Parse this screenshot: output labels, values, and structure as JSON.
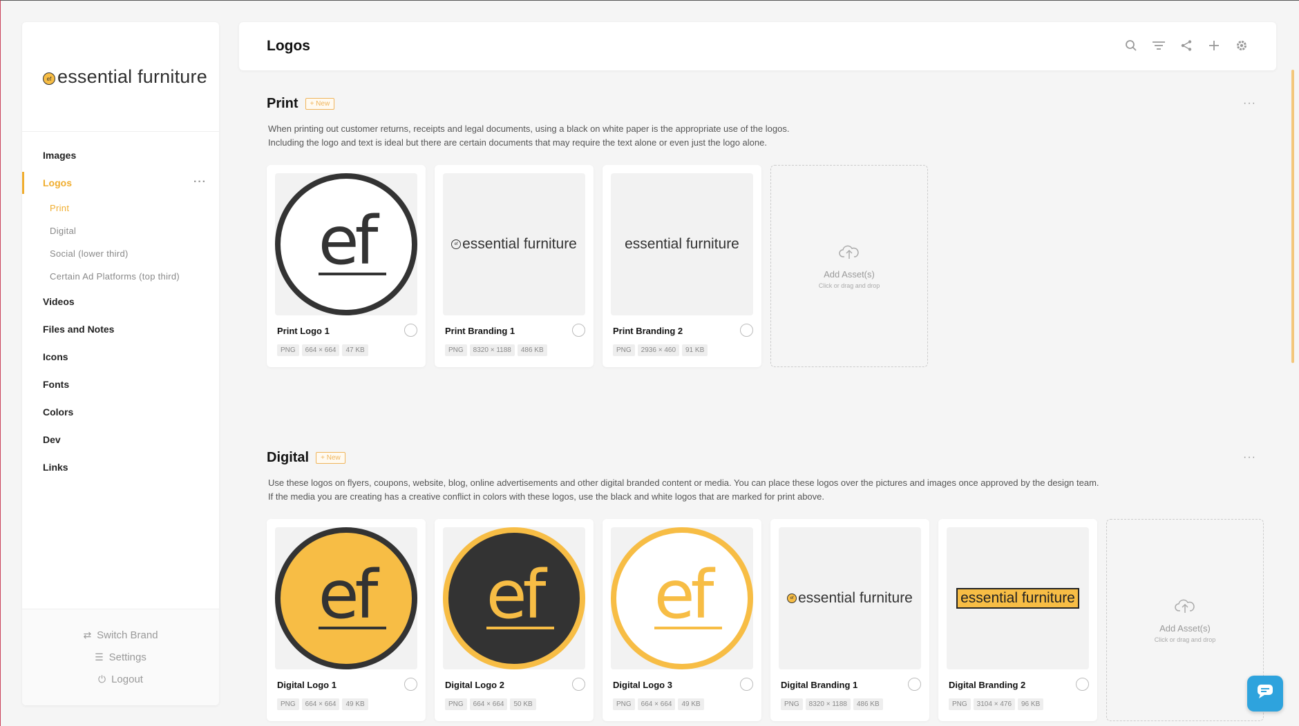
{
  "brand": {
    "name": "essential furniture",
    "mark": "ef"
  },
  "sidebar": {
    "items": [
      {
        "label": "Images"
      },
      {
        "label": "Logos"
      },
      {
        "label": "Videos"
      },
      {
        "label": "Files and Notes"
      },
      {
        "label": "Icons"
      },
      {
        "label": "Fonts"
      },
      {
        "label": "Colors"
      },
      {
        "label": "Dev"
      },
      {
        "label": "Links"
      }
    ],
    "logos_sub": [
      "Print",
      "Digital",
      "Social (lower third)",
      "Certain Ad Platforms (top third)"
    ],
    "footer": {
      "switch_brand": "Switch Brand",
      "settings": "Settings",
      "logout": "Logout"
    }
  },
  "header": {
    "title": "Logos"
  },
  "sections": {
    "print": {
      "title": "Print",
      "badge": "+ New",
      "desc1": "When printing out customer returns, receipts and legal documents, using a black on white paper is the appropriate use of the logos.",
      "desc2": "Including the logo and text is ideal but there are certain documents that may require the text alone or even just the logo alone.",
      "cards": [
        {
          "title": "Print Logo 1",
          "type": "PNG",
          "dims": "664 × 664",
          "size": "47 KB"
        },
        {
          "title": "Print Branding 1",
          "type": "PNG",
          "dims": "8320 × 1188",
          "size": "486 KB"
        },
        {
          "title": "Print Branding 2",
          "type": "PNG",
          "dims": "2936 × 460",
          "size": "91 KB"
        }
      ]
    },
    "digital": {
      "title": "Digital",
      "badge": "+ New",
      "desc1": "Use these logos on flyers, coupons, website, blog, online advertisements and other digital branded content or media. You can place these logos over the pictures and images once approved by the design team.",
      "desc2": "If the media you are creating has a creative conflict in colors  with these logos, use the black and white logos that are marked for print above.",
      "cards": [
        {
          "title": "Digital Logo 1",
          "type": "PNG",
          "dims": "664 × 664",
          "size": "49 KB"
        },
        {
          "title": "Digital Logo 2",
          "type": "PNG",
          "dims": "664 × 664",
          "size": "50 KB"
        },
        {
          "title": "Digital Logo 3",
          "type": "PNG",
          "dims": "664 × 664",
          "size": "49 KB"
        },
        {
          "title": "Digital Branding 1",
          "type": "PNG",
          "dims": "8320 × 1188",
          "size": "486 KB"
        },
        {
          "title": "Digital Branding 2",
          "type": "PNG",
          "dims": "3104 × 476",
          "size": "96 KB"
        }
      ]
    }
  },
  "add_asset": {
    "title": "Add Asset(s)",
    "sub": "Click or drag and drop"
  },
  "colors": {
    "accent": "#f0ad2e",
    "brand_yellow": "#f7bd45",
    "dark": "#333333",
    "chat": "#2ea3dd"
  },
  "icons": [
    "search-icon",
    "filter-icon",
    "share-icon",
    "plus-icon",
    "gear-icon",
    "upload-cloud-icon",
    "chat-icon"
  ]
}
